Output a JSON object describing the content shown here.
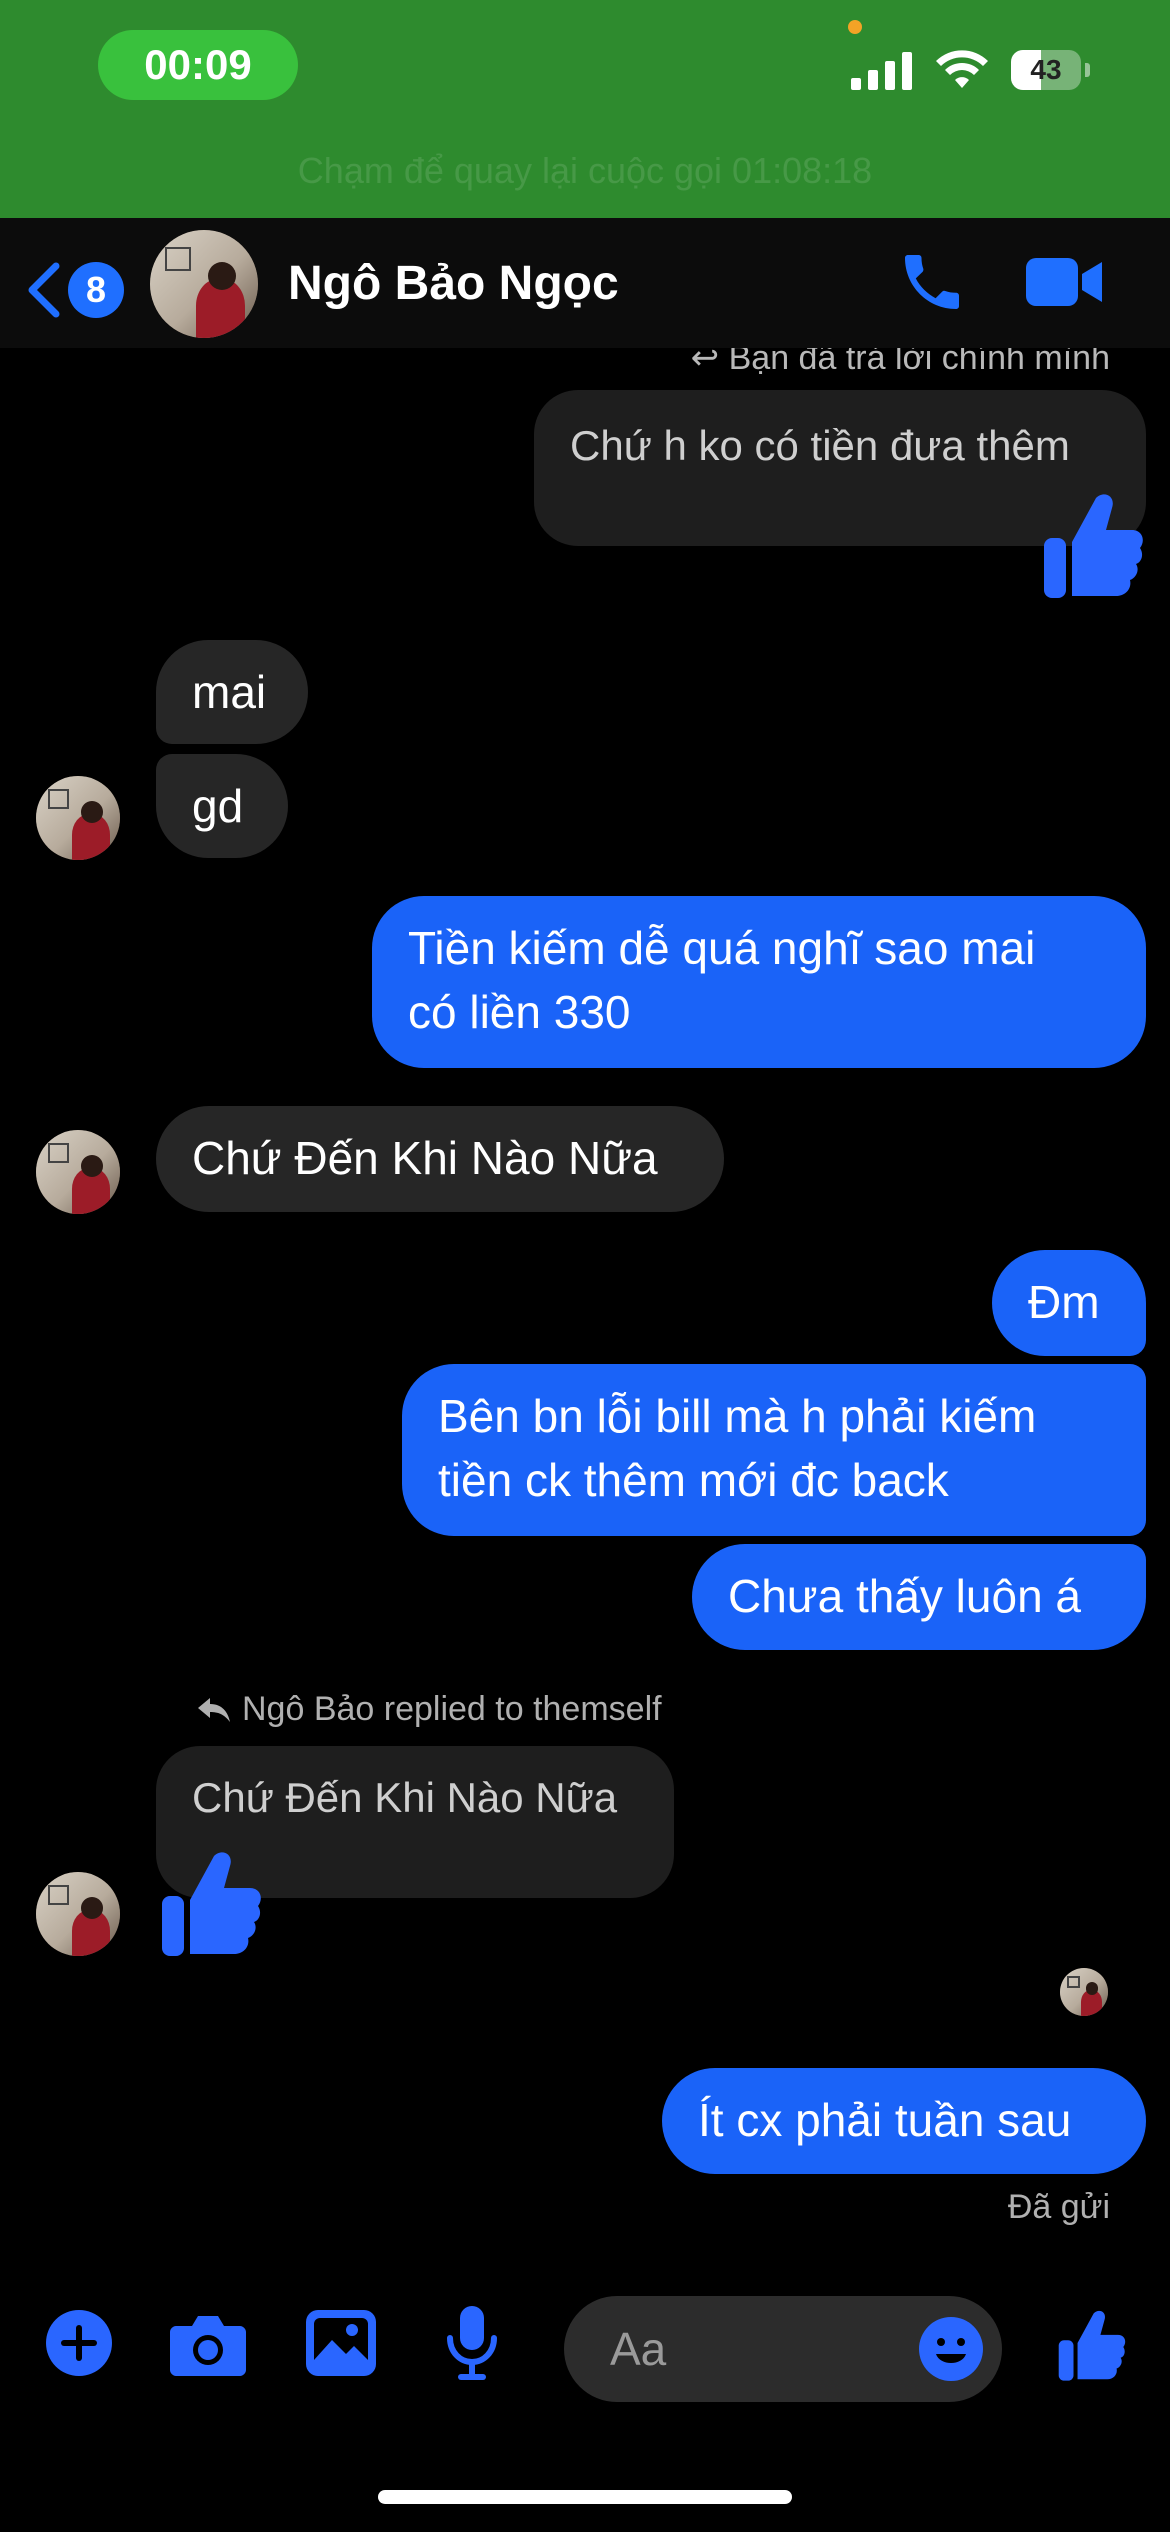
{
  "status_bar": {
    "time": "00:09",
    "battery": "43",
    "battery_level": 0.43,
    "call_banner": "Chạm để quay lại cuộc gọi 01:08:18"
  },
  "header": {
    "back_count": "8",
    "name": "Ngô Bảo Ngọc"
  },
  "messages": {
    "top_reply_hint": "Bạn đã trả lời chính mình",
    "m1": "Chứ h ko có tiền đưa thêm",
    "m2": "mai",
    "m3": "gd",
    "m4_line1": "Tiền kiếm dễ quá nghĩ sao mai",
    "m4_line2": "có liền 330",
    "m5": "Chứ Đến Khi Nào Nữa",
    "m6": "Đm",
    "m7_line1": "Bên bn lỗi bill mà h phải kiếm",
    "m7_line2": "tiền ck thêm mới đc back",
    "m8": "Chưa thấy luôn á",
    "reply_label": "Ngô Bảo replied to themself",
    "m9": "Chứ Đến Khi Nào Nữa",
    "m10": "Ít cx phải tuần sau",
    "sent_status": "Đã gửi"
  },
  "composer": {
    "placeholder": "Aa"
  },
  "colors": {
    "accent": "#1f6fff",
    "status_green": "#2e8b2e",
    "bubble_blue": "#1a63f8",
    "bubble_gray": "#262626"
  },
  "icons": [
    "back-chevron-icon",
    "phone-icon",
    "video-camera-icon",
    "thumbs-up-icon",
    "plus-icon",
    "camera-icon",
    "gallery-icon",
    "microphone-icon",
    "emoji-icon",
    "reply-arrow-icon"
  ]
}
